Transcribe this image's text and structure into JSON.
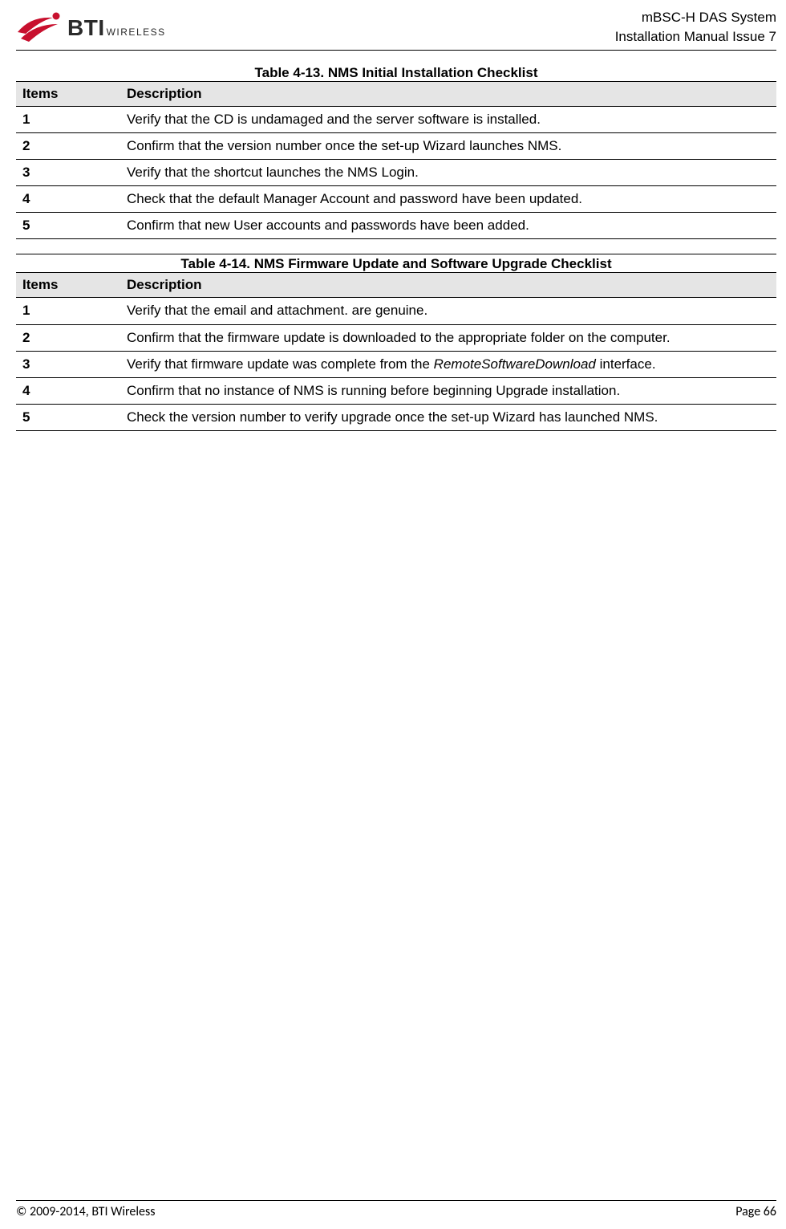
{
  "header": {
    "logo_bti": "BTI",
    "logo_wireless": "WIRELESS",
    "line1": "mBSC-H DAS System",
    "line2": "Installation Manual Issue 7"
  },
  "tables": [
    {
      "caption": "Table 4-13. NMS Initial Installation Checklist",
      "header_items": "Items",
      "header_desc": "Description",
      "rows": [
        {
          "item": "1",
          "desc": "Verify that the CD is undamaged and the server software is installed."
        },
        {
          "item": "2",
          "desc": "Confirm that the version number once the set-up Wizard launches NMS."
        },
        {
          "item": "3",
          "desc": "Verify that the shortcut launches the NMS Login."
        },
        {
          "item": "4",
          "desc": "Check that the default Manager Account and password have been updated."
        },
        {
          "item": "5",
          "desc": "Confirm that new User accounts and passwords have been added."
        }
      ]
    },
    {
      "caption": "Table 4-14. NMS Firmware Update and Software Upgrade Checklist",
      "header_items": "Items",
      "header_desc": "Description",
      "rows": [
        {
          "item": "1",
          "desc": "Verify that the email and attachment. are genuine."
        },
        {
          "item": "2",
          "desc": "Confirm that the firmware update is downloaded to the appropriate folder on the computer."
        },
        {
          "item": "3",
          "desc_pre": "Verify that firmware update was complete from the ",
          "desc_italic": "RemoteSoftwareDownload",
          "desc_post": " interface."
        },
        {
          "item": "4",
          "desc": "Confirm that no instance of NMS is running before beginning Upgrade installation."
        },
        {
          "item": "5",
          "desc": "Check the version number to verify upgrade once the set-up Wizard has launched NMS."
        }
      ]
    }
  ],
  "footer": {
    "copyright": "© 2009-2014, BTI Wireless",
    "page_label": "Page ",
    "page_num": "66"
  }
}
